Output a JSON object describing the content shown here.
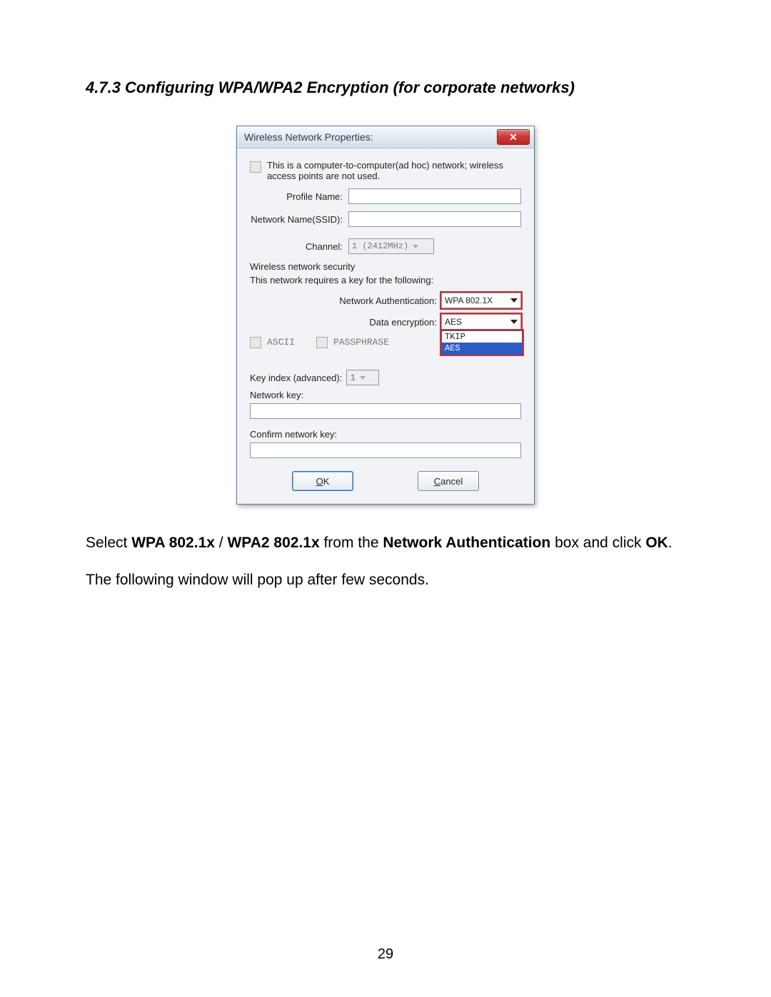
{
  "heading": "4.7.3 Configuring WPA/WPA2 Encryption (for corporate networks)",
  "dialog": {
    "title": "Wireless Network Properties:",
    "adhoc_text": "This is a computer-to-computer(ad hoc) network; wireless access points are not used.",
    "labels": {
      "profile": "Profile Name:",
      "ssid": "Network Name(SSID):",
      "channel": "Channel:",
      "channel_value": "1 (2412MHz)",
      "group": "Wireless network security",
      "group_note": "This network requires a key for the following:",
      "auth": "Network Authentication:",
      "enc": "Data encryption:",
      "ascii": "ASCII",
      "passphrase": "PASSPHRASE",
      "keyidx": "Key index (advanced):",
      "keyidx_value": "1",
      "netkey": "Network key:",
      "confirm": "Confirm network key:"
    },
    "auth_value": "WPA 802.1X",
    "enc_value": "AES",
    "enc_options": {
      "opt1": "TKIP",
      "opt2": "AES"
    },
    "buttons": {
      "ok": "OK",
      "cancel": "Cancel"
    }
  },
  "para1_a": "Select ",
  "para1_b": "WPA 802.1x",
  "para1_c": " / ",
  "para1_d": "WPA2 802.1x",
  "para1_e": " from the ",
  "para1_f": "Network Authentication",
  "para1_g": " box and click ",
  "para1_h": "OK",
  "para1_i": ".",
  "para2": "The following window will pop up after few seconds.",
  "page_number": "29"
}
